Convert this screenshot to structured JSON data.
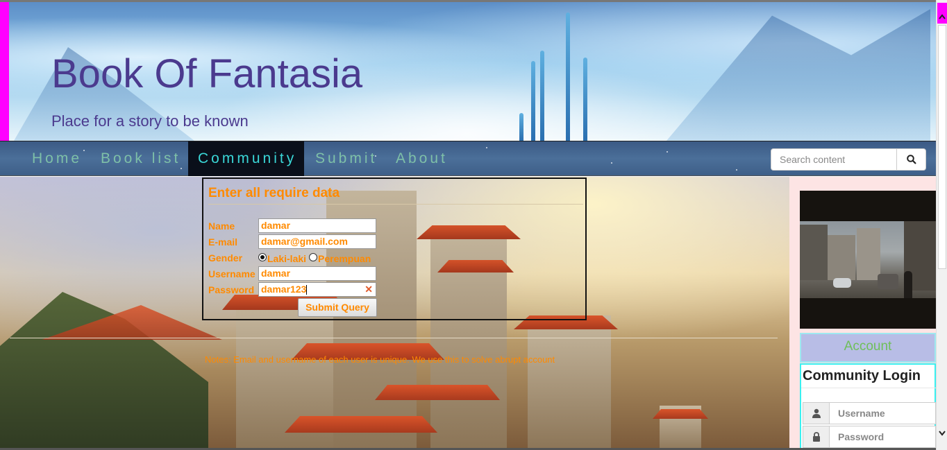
{
  "header": {
    "title": "Book Of Fantasia",
    "tagline": "Place for a story to be known"
  },
  "nav": {
    "items": [
      {
        "label": "Home",
        "active": false
      },
      {
        "label": "Book list",
        "active": false
      },
      {
        "label": "Community",
        "active": true
      },
      {
        "label": "Submit",
        "active": false
      },
      {
        "label": "About",
        "active": false
      }
    ],
    "search": {
      "placeholder": "Search content",
      "icon": "search-icon"
    }
  },
  "form": {
    "title": "Enter all require data",
    "fields": {
      "name": {
        "label": "Name",
        "value": "damar"
      },
      "email": {
        "label": "E-mail",
        "value": "damar@gmail.com"
      },
      "gender": {
        "label": "Gender",
        "options": [
          "Laki-laki",
          "Perempuan"
        ],
        "selected": "Laki-laki"
      },
      "username": {
        "label": "Username",
        "value": "damar"
      },
      "password": {
        "label": "Password",
        "value": "damar123"
      }
    },
    "submit_label": "Submit Query",
    "notes": "Notes: Email and username of each user is unique. We use this to solve abrupt account"
  },
  "sidebar": {
    "account_tab": "Account",
    "login": {
      "title": "Community Login",
      "username_placeholder": "Username",
      "password_placeholder": "Password",
      "username_icon": "user-icon",
      "password_icon": "lock-icon"
    }
  },
  "colors": {
    "accent_orange": "#ff8a00",
    "title_purple": "#4b3a8e",
    "nav_active_text": "#3ad7d7",
    "nav_text": "#7ec0a8",
    "scroll_magenta": "#ff00ff"
  }
}
